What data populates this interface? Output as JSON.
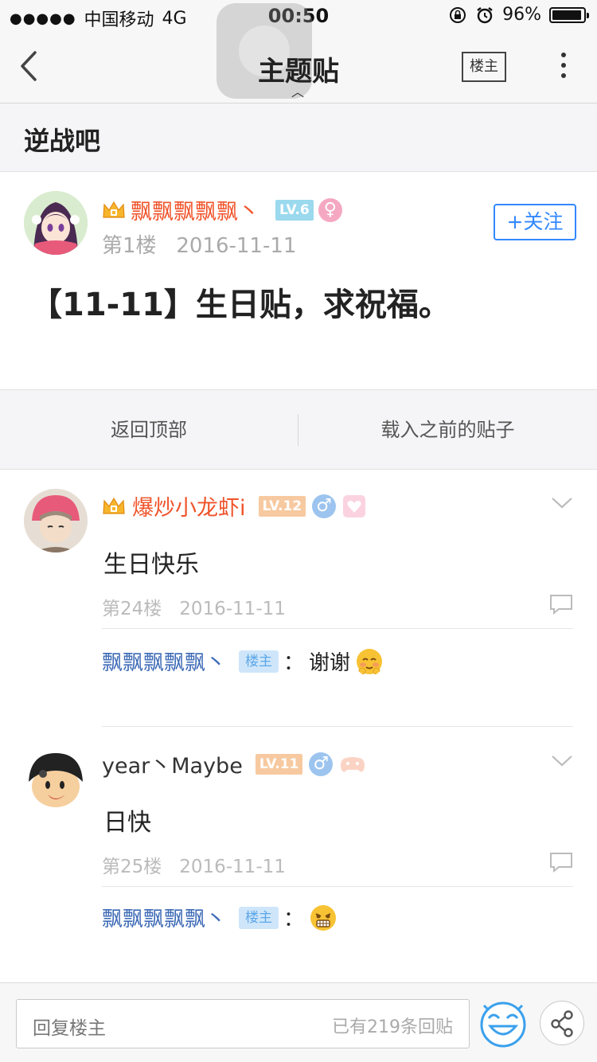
{
  "status_bar": {
    "signal": "●●●●●",
    "carrier": "中国移动",
    "network": "4G",
    "time": "00:50",
    "battery": "96%",
    "battery_level": 0.96
  },
  "nav": {
    "title": "主题贴",
    "owner_button": "楼主"
  },
  "forum": {
    "name": "逆战吧"
  },
  "main_post": {
    "username": "飘飘飘飘飘丶",
    "level": "LV.6",
    "sex": "♀",
    "floor": "第1楼",
    "date": "2016-11-11",
    "follow_label": "+关注",
    "title": "【11-11】生日贴，求祝福。"
  },
  "pager": {
    "back_to_top": "返回顶部",
    "load_previous": "载入之前的贴子"
  },
  "replies": [
    {
      "username": "爆炒小龙虾i",
      "level": "LV.12",
      "sex": "♂",
      "content": "生日快乐",
      "floor": "第24楼",
      "date": "2016-11-11",
      "sub_reply": {
        "username": "飘飘飘飘飘丶",
        "badge": "楼主",
        "separator": "：",
        "text": "谢谢"
      }
    },
    {
      "username": "year丶Maybe",
      "level": "LV.11",
      "sex": "♂",
      "content": "日快",
      "floor": "第25楼",
      "date": "2016-11-11",
      "sub_reply": {
        "username": "飘飘飘飘飘丶",
        "badge": "楼主",
        "separator": "：",
        "text": ""
      }
    }
  ],
  "bottom_bar": {
    "placeholder": "回复楼主",
    "reply_count": "已有219条回贴"
  },
  "colors": {
    "accent_blue": "#3388ff",
    "username_orange": "#f0532a",
    "sub_name_blue": "#3b68b5",
    "lv_cyan": "#9ad9ee",
    "lv_orange": "#f7c9a0"
  }
}
